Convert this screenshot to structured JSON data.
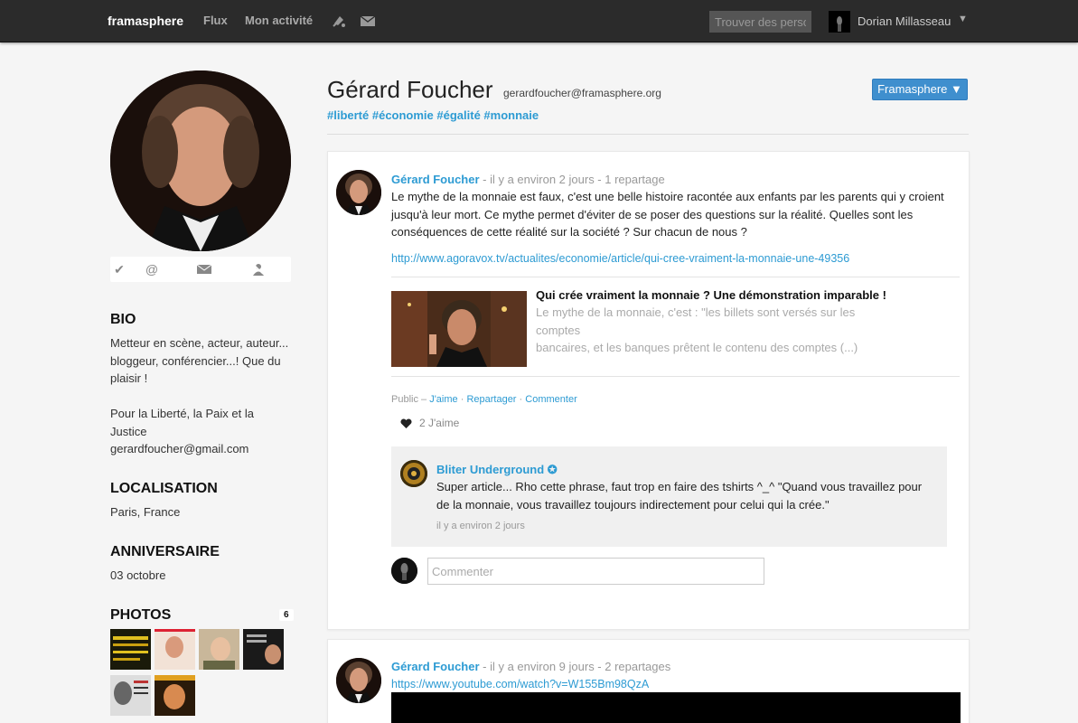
{
  "topbar": {
    "brand": "framasphere",
    "nav": [
      "Flux",
      "Mon activité"
    ],
    "search_placeholder": "Trouver des personnes",
    "user_name": "Dorian Millasseau",
    "caret": "▼"
  },
  "profile": {
    "name": "Gérard Foucher",
    "handle": "gerardfoucher@framasphere.org",
    "tags": "#liberté #économie #égalité #monnaie",
    "aspect_button": "Framasphere ▼",
    "sections": {
      "bio_title": "BIO",
      "bio_lines": [
        "Metteur en scène, acteur, auteur...",
        "bloggeur, conférencier...! Que du",
        "plaisir !"
      ],
      "bio_lines2": [
        "Pour la Liberté, la Paix et la",
        "Justice",
        "gerardfoucher@gmail.com"
      ],
      "location_title": "LOCALISATION",
      "location": "Paris, France",
      "birthday_title": "ANNIVERSAIRE",
      "birthday": "03 octobre",
      "photos_title": "PHOTOS",
      "photos_count": "6"
    }
  },
  "posts": [
    {
      "author": "Gérard Foucher",
      "meta": " - il y a environ 2 jours - 1 repartage",
      "text_lines": [
        "Le mythe de la monnaie est faux, c'est une belle histoire racontée aux enfants par les parents qui y croient",
        "jusqu'à leur mort. Ce mythe permet d'éviter de se poser des questions sur la réalité. Quelles sont les",
        "conséquences de cette réalité sur la société ? Sur chacun de nous ?"
      ],
      "link": "http://www.agoravox.tv/actualites/economie/article/qui-cree-vraiment-la-monnaie-une-49356",
      "preview_title": "Qui crée vraiment la monnaie ? Une démonstration imparable !",
      "preview_desc_lines": [
        "Le mythe de la monnaie, c'est : \"les billets sont versés sur les comptes",
        "bancaires, et les banques prêtent le contenu des comptes (...)"
      ],
      "visibility": "Public – ",
      "action_like": "J'aime",
      "action_share": "Repartager",
      "action_comment": "Commenter",
      "sep": " · ",
      "likes": "2 J'aime",
      "comment": {
        "author": "Bliter Underground ✪",
        "text_lines": [
          "Super article... Rho cette phrase, faut trop en faire des tshirts ^_^ \"Quand vous travaillez pour",
          "de la monnaie, vous travaillez toujours indirectement pour celui qui la crée.\""
        ],
        "time": "il y a environ 2 jours"
      },
      "comment_placeholder": "Commenter"
    },
    {
      "author": "Gérard Foucher",
      "meta": " - il y a environ 9 jours - 2 repartages",
      "link": "https://www.youtube.com/watch?v=W155Bm98QzA"
    }
  ]
}
